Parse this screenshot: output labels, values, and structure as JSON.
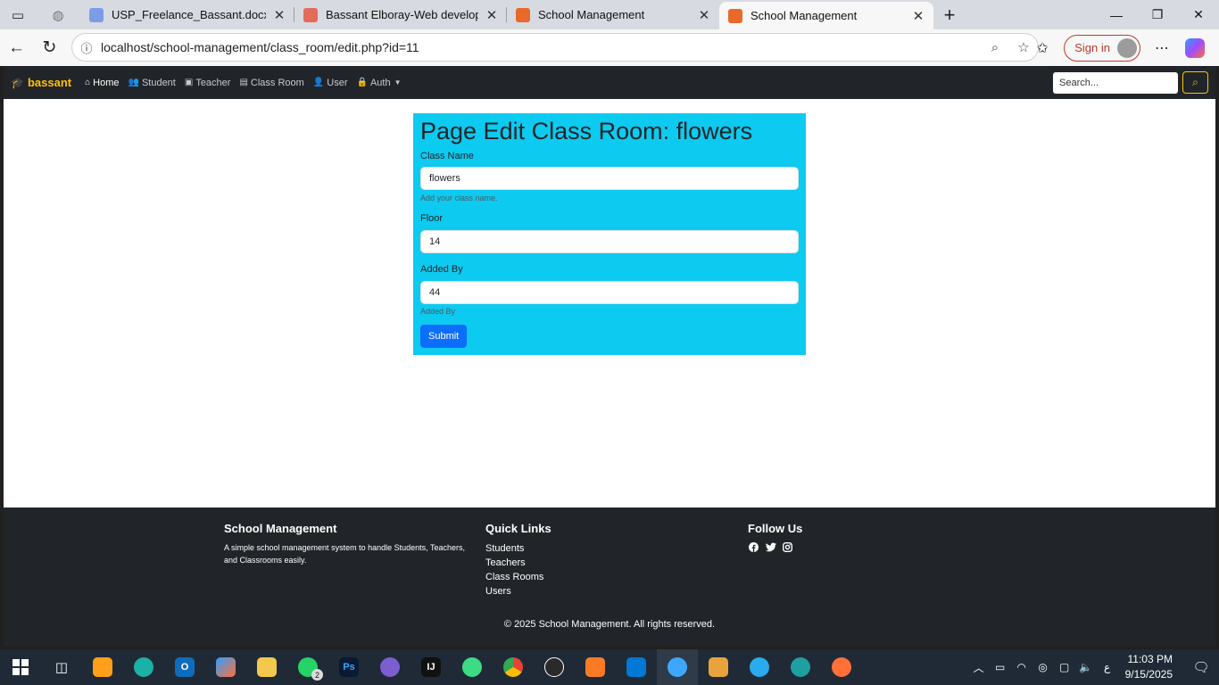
{
  "browser": {
    "tabs": [
      {
        "label": "USP_Freelance_Bassant.docx - ال",
        "color": "#7a9de6",
        "active": false
      },
      {
        "label": "Bassant Elboray-Web developer.p",
        "color": "#e46a5a",
        "active": false
      },
      {
        "label": "School Management",
        "color": "#e8692a",
        "active": false
      },
      {
        "label": "School Management",
        "color": "#e8692a",
        "active": true
      }
    ],
    "url": "localhost/school-management/class_room/edit.php?id=11",
    "signin_label": "Sign in"
  },
  "navbar": {
    "brand": "bassant",
    "links": [
      {
        "label": "Home",
        "icon": "home-icon",
        "glyph": "⌂"
      },
      {
        "label": "Student",
        "icon": "people-icon",
        "glyph": "👥"
      },
      {
        "label": "Teacher",
        "icon": "teacher-icon",
        "glyph": "▣"
      },
      {
        "label": "Class Room",
        "icon": "building-icon",
        "glyph": "▤"
      },
      {
        "label": "User",
        "icon": "user-icon",
        "glyph": "👤"
      },
      {
        "label": "Auth",
        "icon": "lock-icon",
        "glyph": "🔒"
      }
    ],
    "search_placeholder": "Search..."
  },
  "form": {
    "title": "Page Edit Class Room: flowers",
    "class_name_label": "Class Name",
    "class_name_value": "flowers",
    "class_name_help": "Add your class name.",
    "floor_label": "Floor",
    "floor_value": "14",
    "added_by_label": "Added By",
    "added_by_value": "44",
    "added_by_help": "Added By",
    "submit_label": "Submit"
  },
  "footer": {
    "col1_title": "School Management",
    "col1_text": "A simple school management system to handle Students, Teachers, and Classrooms easily.",
    "col2_title": "Quick Links",
    "links": [
      "Students",
      "Teachers",
      "Class Rooms",
      "Users"
    ],
    "col3_title": "Follow Us",
    "copyright": "© 2025 School Management. All rights reserved."
  },
  "taskbar": {
    "whatsapp_badge": "2",
    "lang": "ع",
    "time": "11:03 PM",
    "date": "9/15/2025"
  },
  "colors": {
    "navbar": "#212529",
    "brand": "#ffc107",
    "card": "#0dcaf0",
    "submit": "#0d6efd"
  }
}
